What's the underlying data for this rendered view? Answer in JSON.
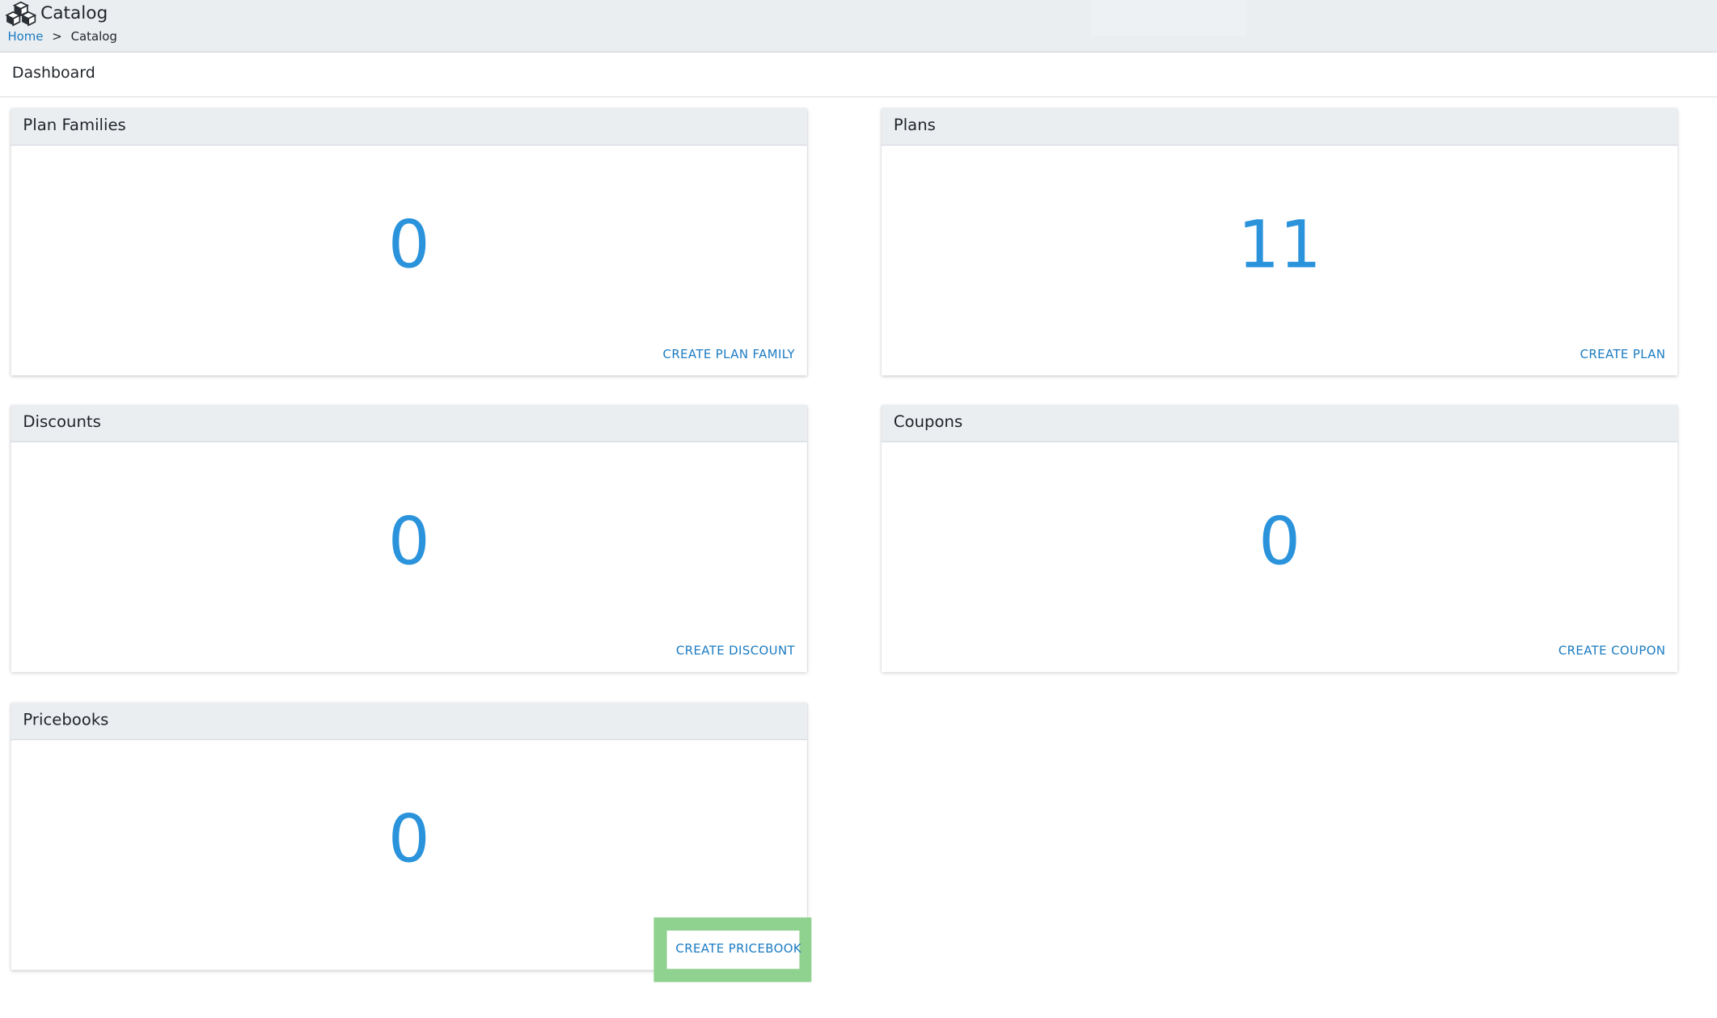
{
  "app": {
    "title": "Catalog",
    "icon": "cubes-icon"
  },
  "breadcrumb": {
    "home": "Home",
    "separator": ">",
    "current": "Catalog"
  },
  "subheader": {
    "title": "Dashboard"
  },
  "cards": [
    {
      "title": "Plan Families",
      "count": "0",
      "action": "CREATE PLAN FAMILY"
    },
    {
      "title": "Plans",
      "count": "11",
      "action": "CREATE PLAN"
    },
    {
      "title": "Discounts",
      "count": "0",
      "action": "CREATE DISCOUNT"
    },
    {
      "title": "Coupons",
      "count": "0",
      "action": "CREATE COUPON"
    },
    {
      "title": "Pricebooks",
      "count": "0",
      "action": "CREATE PRICEBOOK"
    }
  ],
  "colors": {
    "accent": "#2b93db",
    "link": "#1a7bc2",
    "header_bg": "#ebeef1",
    "highlight": "#8fd18f"
  }
}
